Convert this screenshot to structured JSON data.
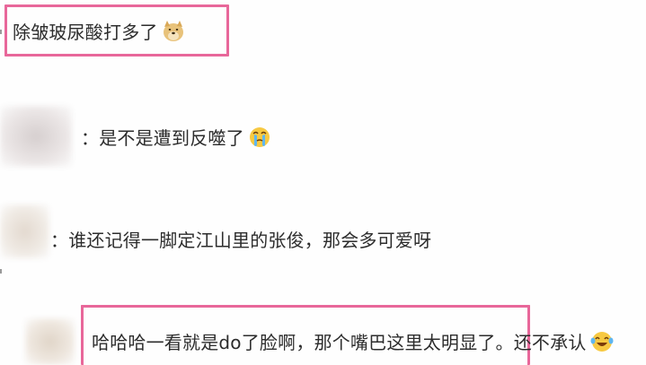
{
  "comments": [
    {
      "text": "除皱玻尿酸打多了",
      "emoji": "doge-emoji"
    },
    {
      "text": "：是不是遭到反噬了",
      "emoji": "crying-emoji"
    },
    {
      "text": "：谁还记得一脚定江山里的张俊，那会多可爱呀",
      "emoji": ""
    },
    {
      "text": "哈哈哈一看就是do了脸啊，那个嘴巴这里太明显了。还不承认",
      "emoji": "laughing-tears-emoji"
    }
  ],
  "colors": {
    "highlight_border": "#e8679a",
    "text": "#2c2c2c",
    "background": "#fefefe"
  }
}
